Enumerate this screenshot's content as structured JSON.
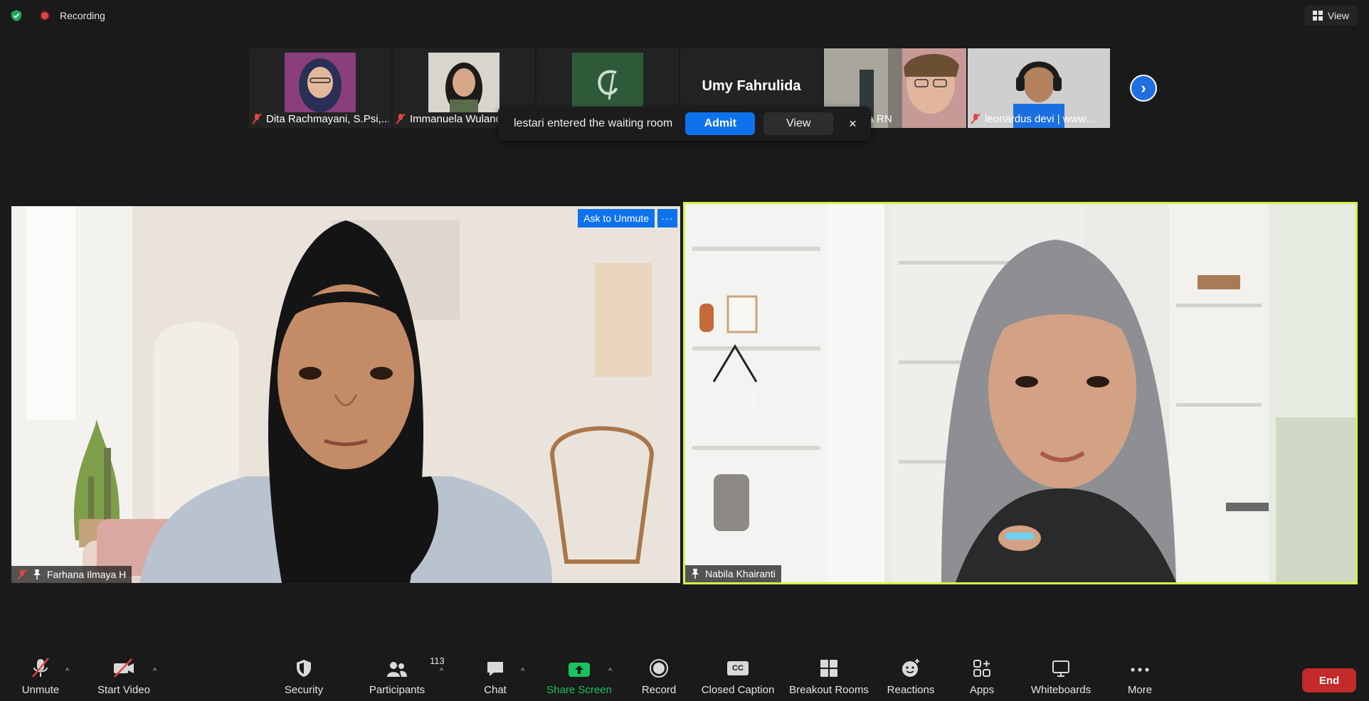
{
  "topbar": {
    "recording_label": "Recording",
    "view_label": "View"
  },
  "thumbnails": [
    {
      "name": "Dita Rachmayani, S.Psi,...",
      "kind": "photo",
      "bg": "#8a3f7a"
    },
    {
      "name": "Immanuela Wuland",
      "kind": "photo",
      "bg": "#d8d5ce"
    },
    {
      "name": "",
      "kind": "logo",
      "bg": "#2f5a3a"
    },
    {
      "name": "Umy Fahrulida",
      "kind": "text"
    },
    {
      "name": "Nabilla RN",
      "kind": "photo",
      "bg": "#9c8f86"
    },
    {
      "name": "leonardus devi | www....",
      "kind": "photo",
      "bg": "#c9c9c9"
    }
  ],
  "notification": {
    "message": "lestari entered the waiting room",
    "admit_label": "Admit",
    "view_label": "View",
    "close_icon": "×",
    "partial_text": "ulida"
  },
  "videos": {
    "left": {
      "name": "Farhana Ilmaya H",
      "ask_unmute_label": "Ask to Unmute",
      "more_label": "···"
    },
    "right": {
      "name": "Nabila Khairanti",
      "active_speaker_color": "#d6f24a"
    }
  },
  "toolbar": {
    "unmute": "Unmute",
    "start_video": "Start Video",
    "security": "Security",
    "participants": "Participants",
    "participants_count": "113",
    "chat": "Chat",
    "share_screen": "Share Screen",
    "record": "Record",
    "closed_caption": "Closed Caption",
    "cc_badge": "CC",
    "breakout_rooms": "Breakout Rooms",
    "reactions": "Reactions",
    "apps": "Apps",
    "whiteboards": "Whiteboards",
    "more": "More",
    "end": "End"
  },
  "colors": {
    "accent_blue": "#0e72ed",
    "share_green": "#19c25f",
    "end_red": "#c42a2a"
  }
}
